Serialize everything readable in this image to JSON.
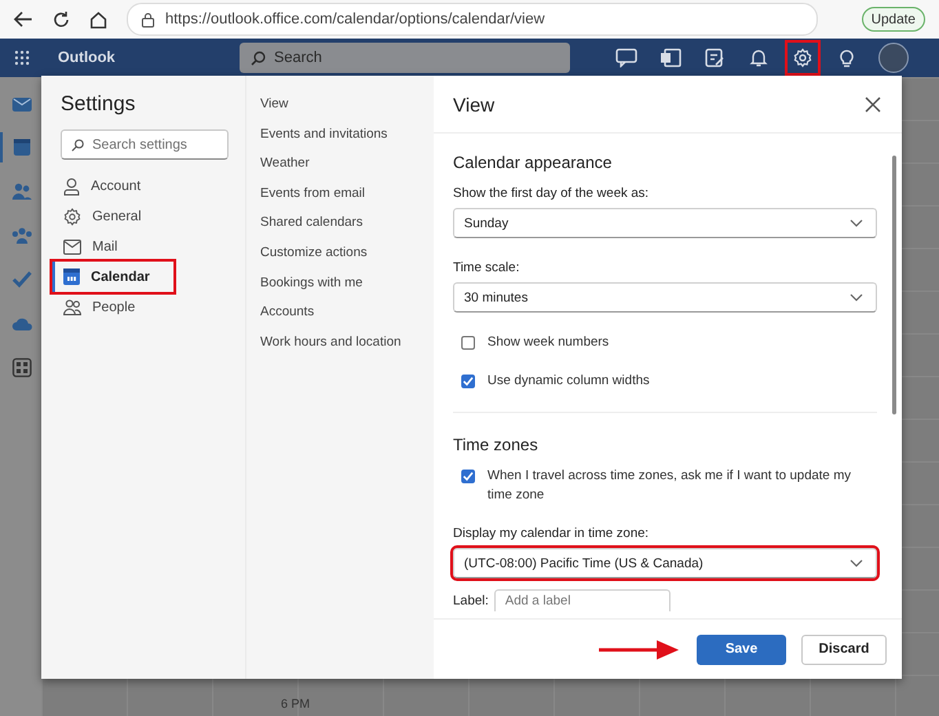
{
  "browser": {
    "url": "https://outlook.office.com/calendar/options/calendar/view",
    "update_button": "Update"
  },
  "app_bar": {
    "app_name": "Outlook",
    "search_placeholder": "Search",
    "toolbar": [
      {
        "kind": "chat",
        "highlighted": false
      },
      {
        "kind": "document",
        "highlighted": false
      },
      {
        "kind": "note",
        "highlighted": false
      },
      {
        "kind": "bell",
        "highlighted": false
      },
      {
        "kind": "gear",
        "highlighted": true
      },
      {
        "kind": "bulb",
        "highlighted": false
      }
    ]
  },
  "rail": [
    {
      "kind": "mail",
      "selected": false
    },
    {
      "kind": "calendar",
      "selected": true
    },
    {
      "kind": "people",
      "selected": false
    },
    {
      "kind": "groups",
      "selected": false
    },
    {
      "kind": "check",
      "selected": false
    },
    {
      "kind": "cloud",
      "selected": false
    },
    {
      "kind": "apps",
      "selected": false
    }
  ],
  "calendar_background": {
    "time_label": "6 PM"
  },
  "settings": {
    "title": "Settings",
    "search_placeholder": "Search settings",
    "categories": [
      {
        "label": "Account",
        "kind": "person",
        "selected": false,
        "highlighted": false
      },
      {
        "label": "General",
        "kind": "gear",
        "selected": false,
        "highlighted": false
      },
      {
        "label": "Mail",
        "kind": "mail",
        "selected": false,
        "highlighted": false
      },
      {
        "label": "Calendar",
        "kind": "calendar",
        "selected": true,
        "highlighted": true
      },
      {
        "label": "People",
        "kind": "people",
        "selected": false,
        "highlighted": false
      }
    ],
    "subnav": [
      "View",
      "Events and invitations",
      "Weather",
      "Events from email",
      "Shared calendars",
      "Customize actions",
      "Bookings with me",
      "Accounts",
      "Work hours and location"
    ]
  },
  "panel": {
    "title": "View",
    "sections": [
      {
        "heading": "Calendar appearance",
        "controls": [
          {
            "kind": "dropdown",
            "label": "Show the first day of the week as:",
            "value": "Sunday",
            "highlighted": false
          },
          {
            "kind": "dropdown",
            "label": "Time scale:",
            "value": "30 minutes",
            "highlighted": false
          },
          {
            "kind": "checkbox",
            "label": "Show week numbers",
            "checked": false
          },
          {
            "kind": "checkbox",
            "label": "Use dynamic column widths",
            "checked": true
          }
        ]
      },
      {
        "heading": "Time zones",
        "controls": [
          {
            "kind": "checkbox",
            "label": "When I travel across time zones, ask me if I want to update my time zone",
            "checked": true
          },
          {
            "kind": "dropdown",
            "label": "Display my calendar in time zone:",
            "value": "(UTC-08:00) Pacific Time (US & Canada)",
            "highlighted": true
          },
          {
            "kind": "text_field",
            "label": "Label:",
            "placeholder": "Add a label"
          }
        ]
      }
    ],
    "buttons": [
      {
        "label": "Save",
        "kind": "primary"
      },
      {
        "label": "Discard",
        "kind": "secondary"
      }
    ],
    "pointer_arrow": true
  }
}
